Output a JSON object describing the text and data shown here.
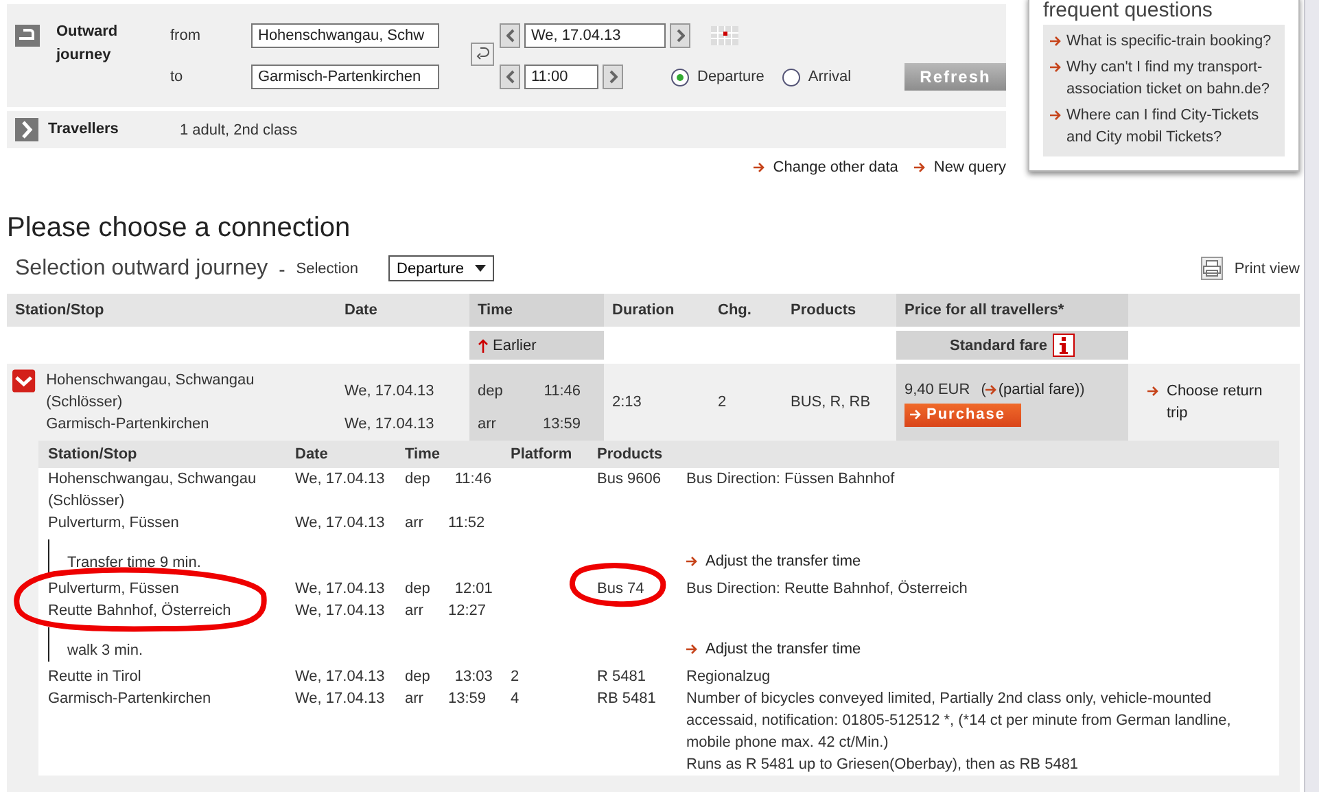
{
  "journey_form": {
    "outward_label": "Outward journey",
    "from_label": "from",
    "from_value": "Hohenschwangau, Schw",
    "to_label": "to",
    "to_value": "Garmisch-Partenkirchen",
    "date_value": "We, 17.04.13",
    "time_value": "11:00",
    "time_mode": [
      {
        "label": "Departure",
        "selected": true
      },
      {
        "label": "Arrival",
        "selected": false
      }
    ],
    "refresh_button": "Refresh"
  },
  "travellers": {
    "label": "Travellers",
    "value": "1 adult, 2nd class"
  },
  "links": [
    "Change other data",
    "New query"
  ],
  "faq": {
    "title": "frequent questions",
    "items": [
      "What is specific-train booking?",
      "Why can't I find my transport-association ticket on bahn.de?",
      "Where can I find City-Tickets and City mobil Tickets?"
    ]
  },
  "heading": "Please choose a connection",
  "selection": {
    "title": "Selection outward journey",
    "separator": "-",
    "label": "Selection",
    "dropdown": "Departure"
  },
  "print_view": "Print view",
  "results": {
    "columns": [
      "Station/Stop",
      "Date",
      "Time",
      "Duration",
      "Chg.",
      "Products",
      "Price for all travellers*"
    ],
    "earlier": "Earlier",
    "fare_type": "Standard fare",
    "connection": {
      "expanded": true,
      "from": "Hohenschwangau, Schwangau (Schlösser)",
      "from_date": "We, 17.04.13",
      "to": "Garmisch-Partenkirchen",
      "to_date": "We, 17.04.13",
      "dep_label": "dep",
      "dep_time": "11:46",
      "arr_label": "arr",
      "arr_time": "13:59",
      "duration": "2:13",
      "changes": "2",
      "products": "BUS, R, RB",
      "price": "9,40 EUR",
      "note_open": "(",
      "note_link": "(partial fare)",
      "note_close": ")",
      "purchase": "Purchase",
      "return_link": "Choose return trip"
    }
  },
  "details": {
    "columns": [
      "Station/Stop",
      "Date",
      "Time",
      "Platform",
      "Products"
    ],
    "rows": [
      {
        "kind": "stop",
        "station": "Hohenschwangau, Schwangau (Schlösser)",
        "date": "We, 17.04.13",
        "time_label": "dep",
        "time": "11:46",
        "product": "Bus 9606",
        "remarks": [
          "Bus Direction: Füssen Bahnhof"
        ]
      },
      {
        "kind": "stop",
        "station": "Pulverturm, Füssen",
        "date": "We, 17.04.13",
        "time_label": "arr",
        "time": "11:52"
      },
      {
        "kind": "transfer",
        "text": "Transfer time 9 min.",
        "link": "Adjust the transfer time"
      },
      {
        "kind": "stop",
        "station": "Pulverturm, Füssen",
        "date": "We, 17.04.13",
        "time_label": "dep",
        "time": "12:01",
        "product": "Bus 74",
        "remarks": [
          "Bus Direction: Reutte Bahnhof, Österreich"
        ]
      },
      {
        "kind": "stop",
        "station": "Reutte Bahnhof, Österreich",
        "date": "We, 17.04.13",
        "time_label": "arr",
        "time": "12:27"
      },
      {
        "kind": "transfer",
        "text": "walk  3 min.",
        "link": "Adjust the transfer time"
      },
      {
        "kind": "stop",
        "station": "Reutte in Tirol",
        "date": "We, 17.04.13",
        "time_label": "dep",
        "time": "13:03",
        "platform": "2",
        "product": "R 5481",
        "remarks": [
          "Regionalzug"
        ]
      },
      {
        "kind": "stop",
        "station": "Garmisch-Partenkirchen",
        "date": "We, 17.04.13",
        "time_label": "arr",
        "time": "13:59",
        "platform": "4",
        "product": "RB 5481",
        "remarks": [
          "Number of bicycles conveyed limited, Partially 2nd class only, vehicle-mounted accessaid, notification: 01805-512512 *, (*14 ct per minute from German landline, mobile phone max. 42 ct/Min.)",
          "Runs as R 5481 up to Griesen(Oberbay), then as RB 5481"
        ]
      }
    ]
  }
}
